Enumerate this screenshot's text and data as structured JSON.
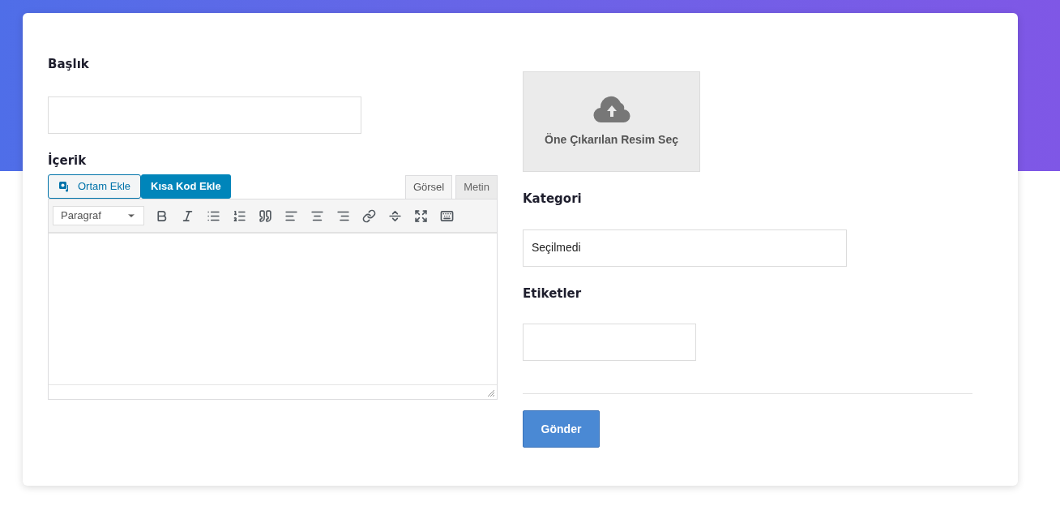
{
  "form": {
    "title_label": "Başlık",
    "content_label": "İçerik",
    "media_buttons": [
      {
        "label": "Ortam Ekle",
        "kind": "media"
      },
      {
        "label": "Kısa Kod Ekle",
        "kind": "shortcode"
      }
    ],
    "editor_tabs": [
      {
        "label": "Görsel",
        "selected": true
      },
      {
        "label": "Metin",
        "selected": false
      }
    ],
    "format_select": "Paragraf",
    "featured_image": {
      "label": "Öne Çıkarılan Resim Seç"
    },
    "category_label": "Kategori",
    "category_value": "Seçilmedi",
    "tags_label": "Etiketler",
    "submit": "Gönder"
  }
}
